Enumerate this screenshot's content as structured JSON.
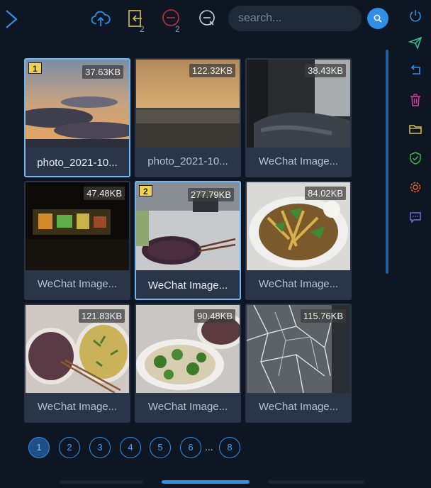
{
  "toolbar": {
    "back_icon": "chevron-right-icon",
    "upload_icon": "cloud-upload-icon",
    "move_icon": "move-out-icon",
    "move_count": "2",
    "remove_icon": "minus-circle-icon",
    "remove_count": "2",
    "clear_icon": "clear-selection-icon",
    "search_placeholder": "search...",
    "search_value": "",
    "search_icon": "search-icon"
  },
  "right_rail": [
    {
      "icon": "power-icon",
      "color": "#2f8fe6"
    },
    {
      "icon": "send-icon",
      "color": "#3dbf8a"
    },
    {
      "icon": "undo-icon",
      "color": "#2f8fe6"
    },
    {
      "icon": "trash-icon",
      "color": "#d83aa0"
    },
    {
      "icon": "folder-icon",
      "color": "#d4c24a"
    },
    {
      "icon": "shield-check-icon",
      "color": "#39b54a"
    },
    {
      "icon": "gear-icon",
      "color": "#e0632f"
    },
    {
      "icon": "chat-icon",
      "color": "#6f6fd8"
    }
  ],
  "images": [
    {
      "name": "photo_2021-10...",
      "size": "37.63KB",
      "badge": "1",
      "selected": true,
      "scene": "sunset-clouds"
    },
    {
      "name": "photo_2021-10...",
      "size": "122.32KB",
      "badge": "",
      "selected": false,
      "scene": "sea-dusk"
    },
    {
      "name": "WeChat Image...",
      "size": "38.43KB",
      "badge": "",
      "selected": false,
      "scene": "bedroom"
    },
    {
      "name": "WeChat Image...",
      "size": "47.48KB",
      "badge": "",
      "selected": false,
      "scene": "night-lights"
    },
    {
      "name": "WeChat Image...",
      "size": "277.79KB",
      "badge": "2",
      "selected": true,
      "scene": "rice-desk"
    },
    {
      "name": "WeChat Image...",
      "size": "84.02KB",
      "badge": "",
      "selected": false,
      "scene": "noodles"
    },
    {
      "name": "WeChat Image...",
      "size": "121.83KB",
      "badge": "",
      "selected": false,
      "scene": "two-plates"
    },
    {
      "name": "WeChat Image...",
      "size": "90.48KB",
      "badge": "",
      "selected": false,
      "scene": "broccoli"
    },
    {
      "name": "WeChat Image...",
      "size": "115.76KB",
      "badge": "",
      "selected": false,
      "scene": "cracked-glass"
    }
  ],
  "pagination": {
    "pages": [
      "1",
      "2",
      "3",
      "4",
      "5",
      "6"
    ],
    "ellipsis": "...",
    "last": "8",
    "current": "1"
  }
}
